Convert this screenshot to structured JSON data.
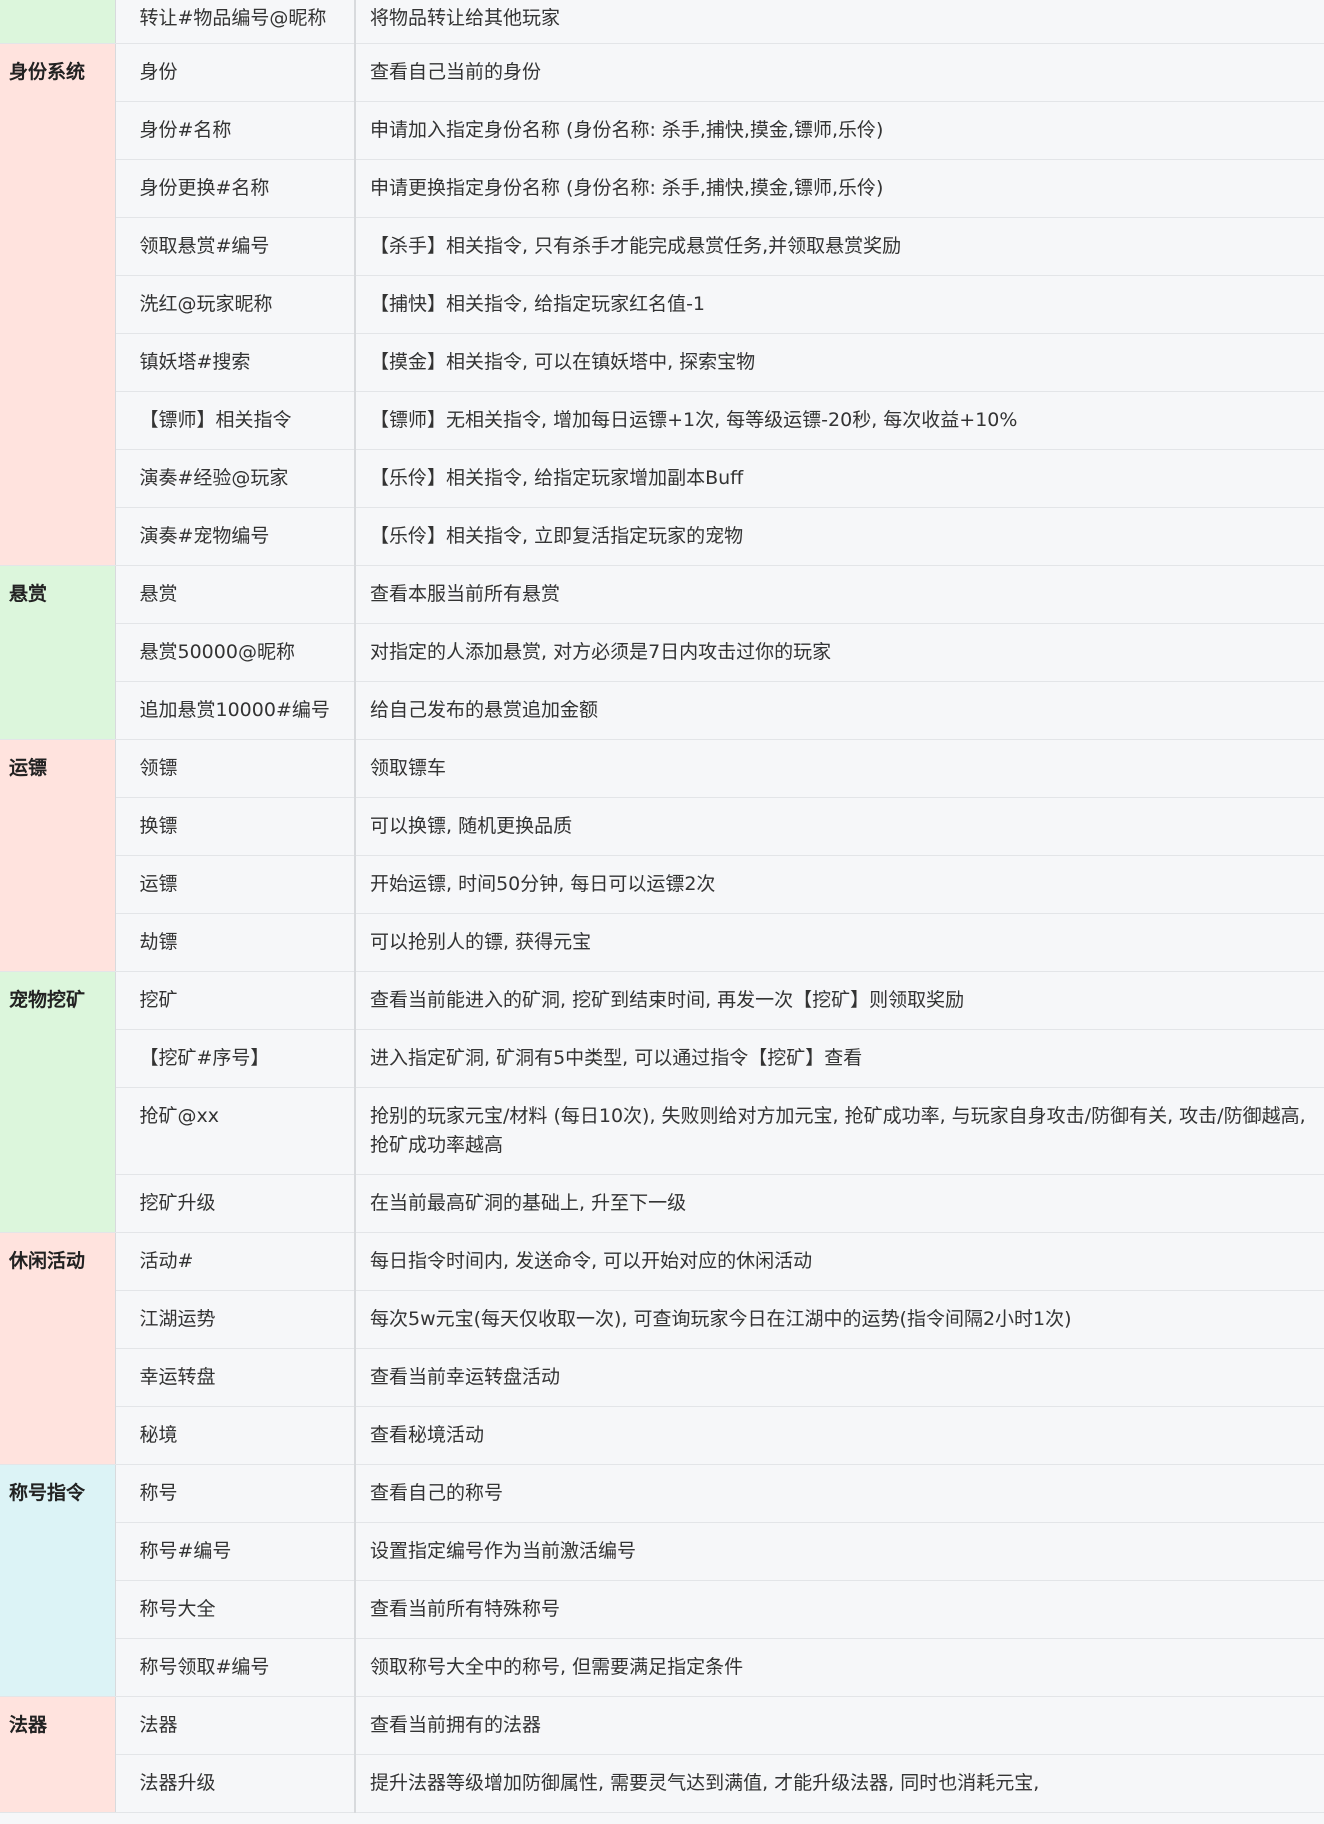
{
  "groups": [
    {
      "category": "",
      "color": "green",
      "rows": [
        {
          "cmd": "转让#物品编号@昵称",
          "desc": "将物品转让给其他玩家"
        }
      ]
    },
    {
      "category": "身份系统",
      "color": "red",
      "rows": [
        {
          "cmd": "身份",
          "desc": "查看自己当前的身份"
        },
        {
          "cmd": "身份#名称",
          "desc": "申请加入指定身份名称 (身份名称: 杀手,捕快,摸金,镖师,乐伶)"
        },
        {
          "cmd": "身份更换#名称",
          "desc": "申请更换指定身份名称 (身份名称: 杀手,捕快,摸金,镖师,乐伶)"
        },
        {
          "cmd": "领取悬赏#编号",
          "desc": "【杀手】相关指令, 只有杀手才能完成悬赏任务,并领取悬赏奖励"
        },
        {
          "cmd": "洗红@玩家昵称",
          "desc": "【捕快】相关指令, 给指定玩家红名值-1"
        },
        {
          "cmd": "镇妖塔#搜索",
          "desc": "【摸金】相关指令, 可以在镇妖塔中, 探索宝物"
        },
        {
          "cmd": "【镖师】相关指令",
          "desc": "【镖师】无相关指令, 增加每日运镖+1次, 每等级运镖-20秒, 每次收益+10%"
        },
        {
          "cmd": "演奏#经验@玩家",
          "desc": "【乐伶】相关指令, 给指定玩家增加副本Buff"
        },
        {
          "cmd": "演奏#宠物编号",
          "desc": "【乐伶】相关指令, 立即复活指定玩家的宠物"
        }
      ]
    },
    {
      "category": "悬赏",
      "color": "green",
      "rows": [
        {
          "cmd": "悬赏",
          "desc": "查看本服当前所有悬赏"
        },
        {
          "cmd": "悬赏50000@昵称",
          "desc": "对指定的人添加悬赏, 对方必须是7日内攻击过你的玩家"
        },
        {
          "cmd": "追加悬赏10000#编号",
          "desc": "给自己发布的悬赏追加金额"
        }
      ]
    },
    {
      "category": "运镖",
      "color": "red",
      "rows": [
        {
          "cmd": "领镖",
          "desc": "领取镖车"
        },
        {
          "cmd": "换镖",
          "desc": "可以换镖, 随机更换品质"
        },
        {
          "cmd": "运镖",
          "desc": "开始运镖, 时间50分钟, 每日可以运镖2次"
        },
        {
          "cmd": "劫镖",
          "desc": "可以抢别人的镖, 获得元宝"
        }
      ]
    },
    {
      "category": "宠物挖矿",
      "color": "green",
      "rows": [
        {
          "cmd": "挖矿",
          "desc": "查看当前能进入的矿洞, 挖矿到结束时间, 再发一次【挖矿】则领取奖励"
        },
        {
          "cmd": "【挖矿#序号】",
          "desc": "进入指定矿洞, 矿洞有5中类型, 可以通过指令【挖矿】查看"
        },
        {
          "cmd": "抢矿@xx",
          "desc": "抢别的玩家元宝/材料 (每日10次), 失败则给对方加元宝, 抢矿成功率, 与玩家自身攻击/防御有关, 攻击/防御越高, 抢矿成功率越高"
        },
        {
          "cmd": "挖矿升级",
          "desc": "在当前最高矿洞的基础上, 升至下一级"
        }
      ]
    },
    {
      "category": "休闲活动",
      "color": "red",
      "rows": [
        {
          "cmd": "活动#",
          "desc": "每日指令时间内, 发送命令, 可以开始对应的休闲活动"
        },
        {
          "cmd": "江湖运势",
          "desc": "每次5w元宝(每天仅收取一次), 可查询玩家今日在江湖中的运势(指令间隔2小时1次)"
        },
        {
          "cmd": "幸运转盘",
          "desc": "查看当前幸运转盘活动"
        },
        {
          "cmd": "秘境",
          "desc": "查看秘境活动"
        }
      ]
    },
    {
      "category": "称号指令",
      "color": "blue",
      "rows": [
        {
          "cmd": "称号",
          "desc": "查看自己的称号"
        },
        {
          "cmd": "称号#编号",
          "desc": "设置指定编号作为当前激活编号"
        },
        {
          "cmd": "称号大全",
          "desc": "查看当前所有特殊称号"
        },
        {
          "cmd": "称号领取#编号",
          "desc": "领取称号大全中的称号, 但需要满足指定条件"
        }
      ]
    },
    {
      "category": "法器",
      "color": "red",
      "rows": [
        {
          "cmd": "法器",
          "desc": "查看当前拥有的法器"
        },
        {
          "cmd": "法器升级",
          "desc": "提升法器等级增加防御属性, 需要灵气达到满值, 才能升级法器, 同时也消耗元宝,"
        }
      ]
    }
  ]
}
